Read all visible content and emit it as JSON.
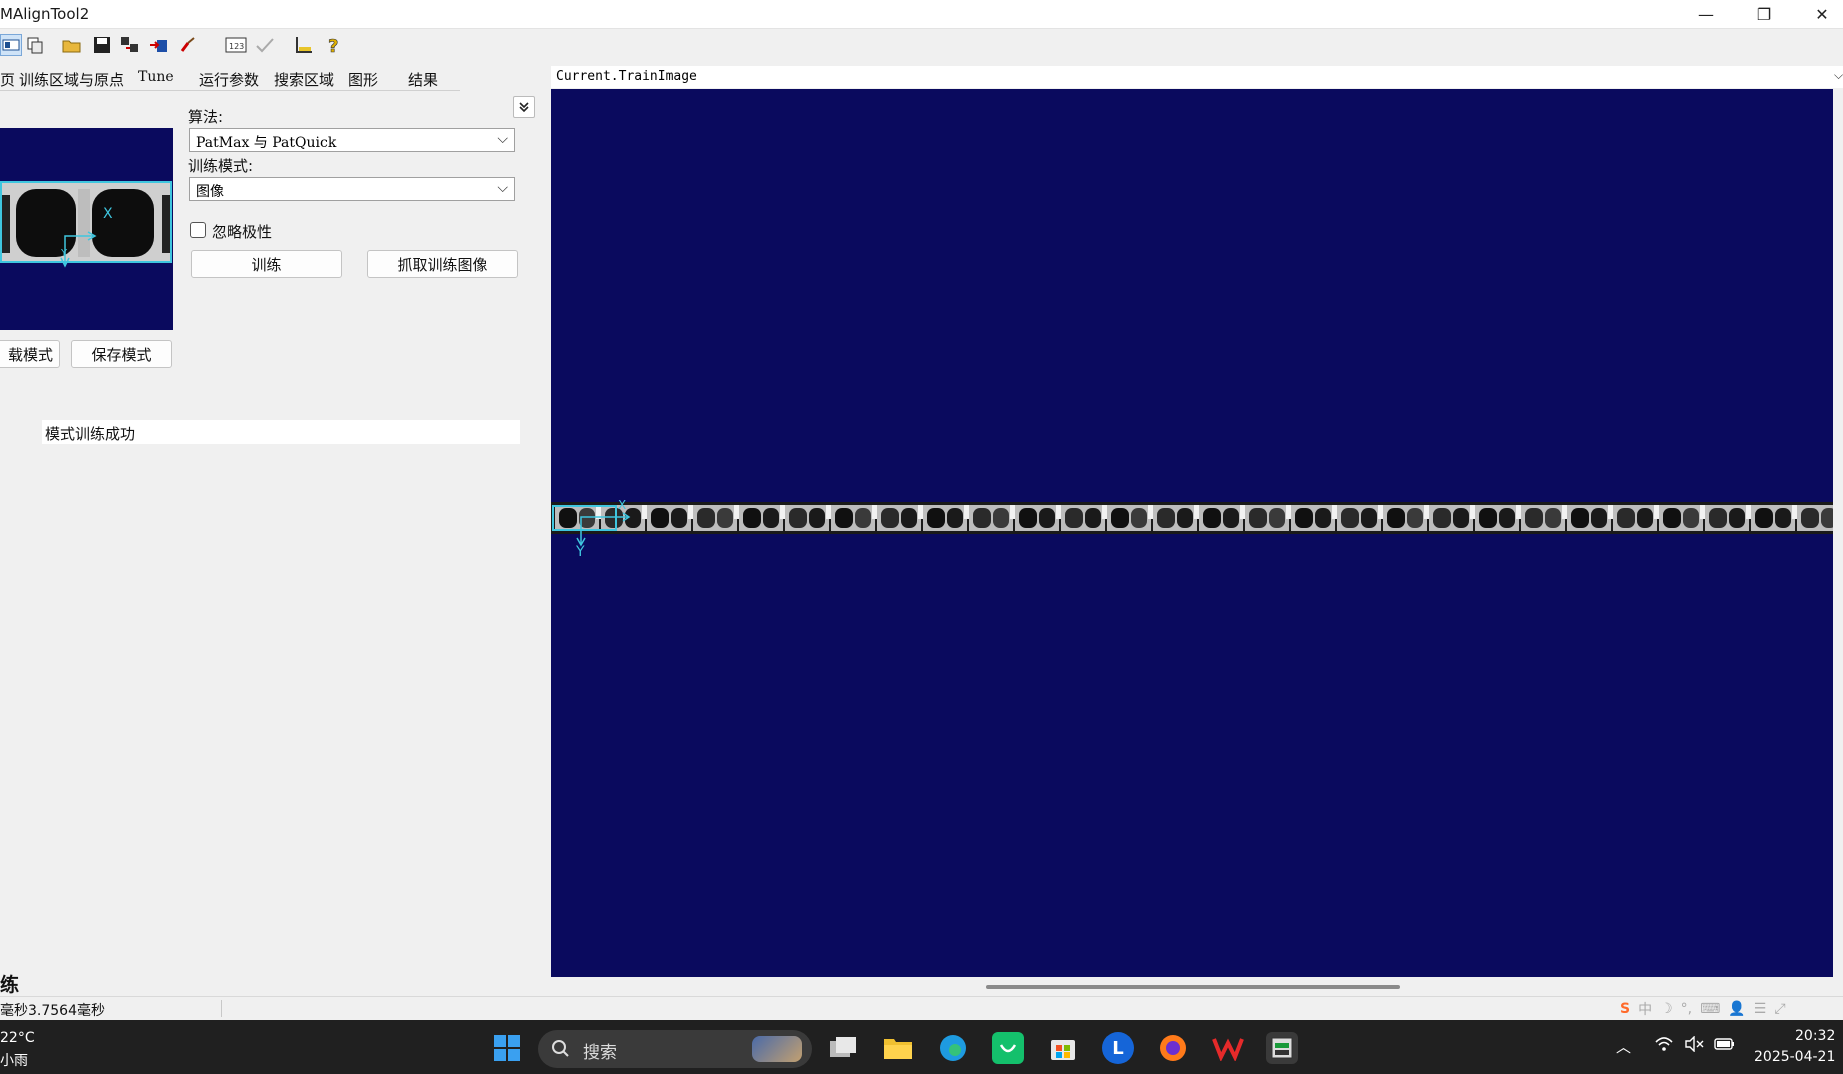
{
  "window": {
    "title": "MAlignTool2",
    "minimize": "—",
    "restore": "❐",
    "close": "✕"
  },
  "toolbar": {
    "icons": [
      "view-icon",
      "copy-icon",
      "open-folder-icon",
      "save-icon",
      "grab-image-icon",
      "import-icon",
      "paint-icon",
      "numeric-display-icon",
      "check-mark-icon",
      "ruler-icon",
      "help-icon"
    ]
  },
  "tabs": [
    {
      "label": "页"
    },
    {
      "label": "训练区域与原点"
    },
    {
      "label": "Tune"
    },
    {
      "label": "运行参数"
    },
    {
      "label": "搜索区域"
    },
    {
      "label": "图形"
    },
    {
      "label": "结果"
    }
  ],
  "train": {
    "algorithm_label": "算法:",
    "algorithm_value": "PatMax 与 PatQuick",
    "mode_label": "训练模式:",
    "mode_value": "图像",
    "ignore_polarity": "忽略极性",
    "train_button": "训练",
    "grab_button": "抓取训练图像",
    "load_model_button": "载模式",
    "save_model_button": "保存模式",
    "status_message": "模式训练成功",
    "expand_icon": "chevron-double-down-icon",
    "thumb_axis_x": "X",
    "thumb_axis_y": "Y"
  },
  "viewer": {
    "header": "Current.TrainImage",
    "axis_y": "Y",
    "axis_x": "X"
  },
  "footer": {
    "section_label": "练",
    "timing_text": "毫秒3.7564毫秒"
  },
  "taskbar": {
    "weather_temp": "22°C",
    "weather_desc": "小雨",
    "search_placeholder": "搜索",
    "time": "20:32",
    "date": "2025-04-21"
  },
  "colors": {
    "viewer_bg": "#0a0a5e",
    "roi_cyan": "#3fc6df",
    "taskbar_bg": "#202020"
  }
}
